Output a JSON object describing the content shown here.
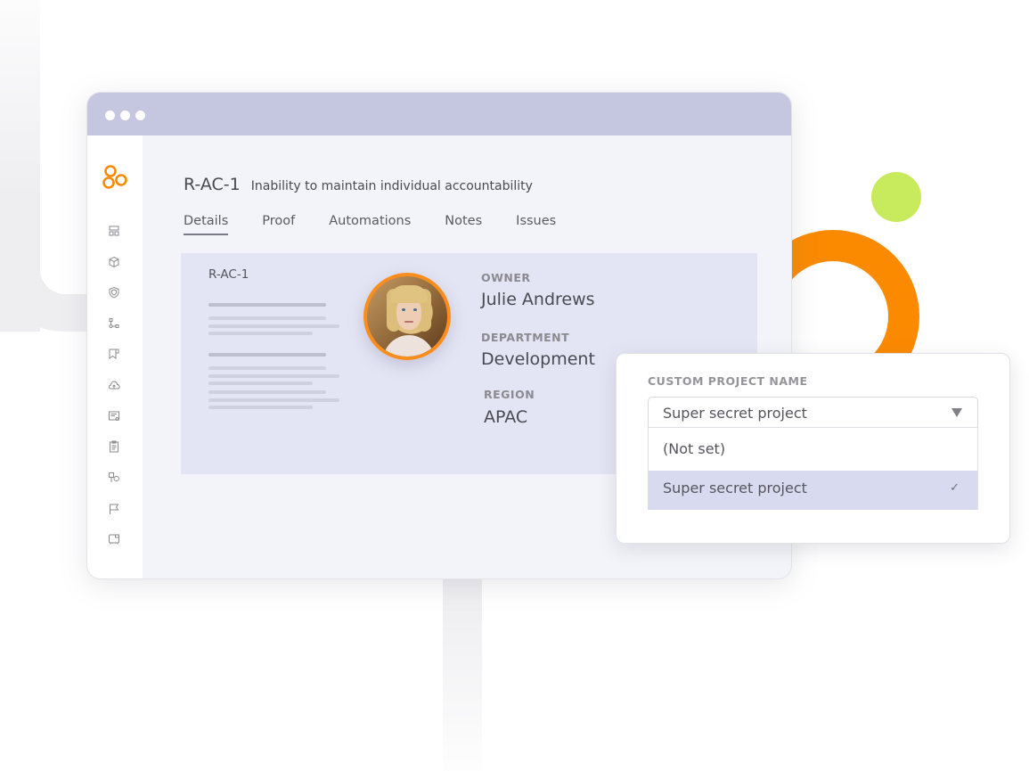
{
  "window": {
    "titlebar_dots": 3
  },
  "sidebar": {
    "logo": "three-rings-logo",
    "items": [
      {
        "icon": "dashboard-icon"
      },
      {
        "icon": "cube-icon"
      },
      {
        "icon": "shield-icon"
      },
      {
        "icon": "workflow-icon"
      },
      {
        "icon": "bookmark-flag-icon"
      },
      {
        "icon": "cloud-upload-icon"
      },
      {
        "icon": "certificate-icon"
      },
      {
        "icon": "clipboard-icon"
      },
      {
        "icon": "people-icon"
      },
      {
        "icon": "flag-icon"
      },
      {
        "icon": "device-icon"
      }
    ]
  },
  "header": {
    "id": "R-AC-1",
    "title": "Inability to maintain individual accountability"
  },
  "tabs": [
    {
      "label": "Details",
      "active": true
    },
    {
      "label": "Proof",
      "active": false
    },
    {
      "label": "Automations",
      "active": false
    },
    {
      "label": "Notes",
      "active": false
    },
    {
      "label": "Issues",
      "active": false
    }
  ],
  "panel": {
    "id": "R-AC-1",
    "owner_label": "OWNER",
    "owner": "Julie Andrews",
    "department_label": "DEPARTMENT",
    "department": "Development",
    "region_label": "REGION",
    "region": "APAC"
  },
  "dropdown": {
    "label": "CUSTOM PROJECT NAME",
    "selected": "Super secret project",
    "options": [
      {
        "label": "(Not set)",
        "selected": false
      },
      {
        "label": "Super secret project",
        "selected": true
      }
    ],
    "check_glyph": "✓"
  },
  "colors": {
    "accent_orange": "#fb8a00",
    "accent_green": "#c7eb5c",
    "titlebar": "#c5c6e0",
    "panel": "#e4e5f4",
    "selected_option": "#d8daf0"
  }
}
